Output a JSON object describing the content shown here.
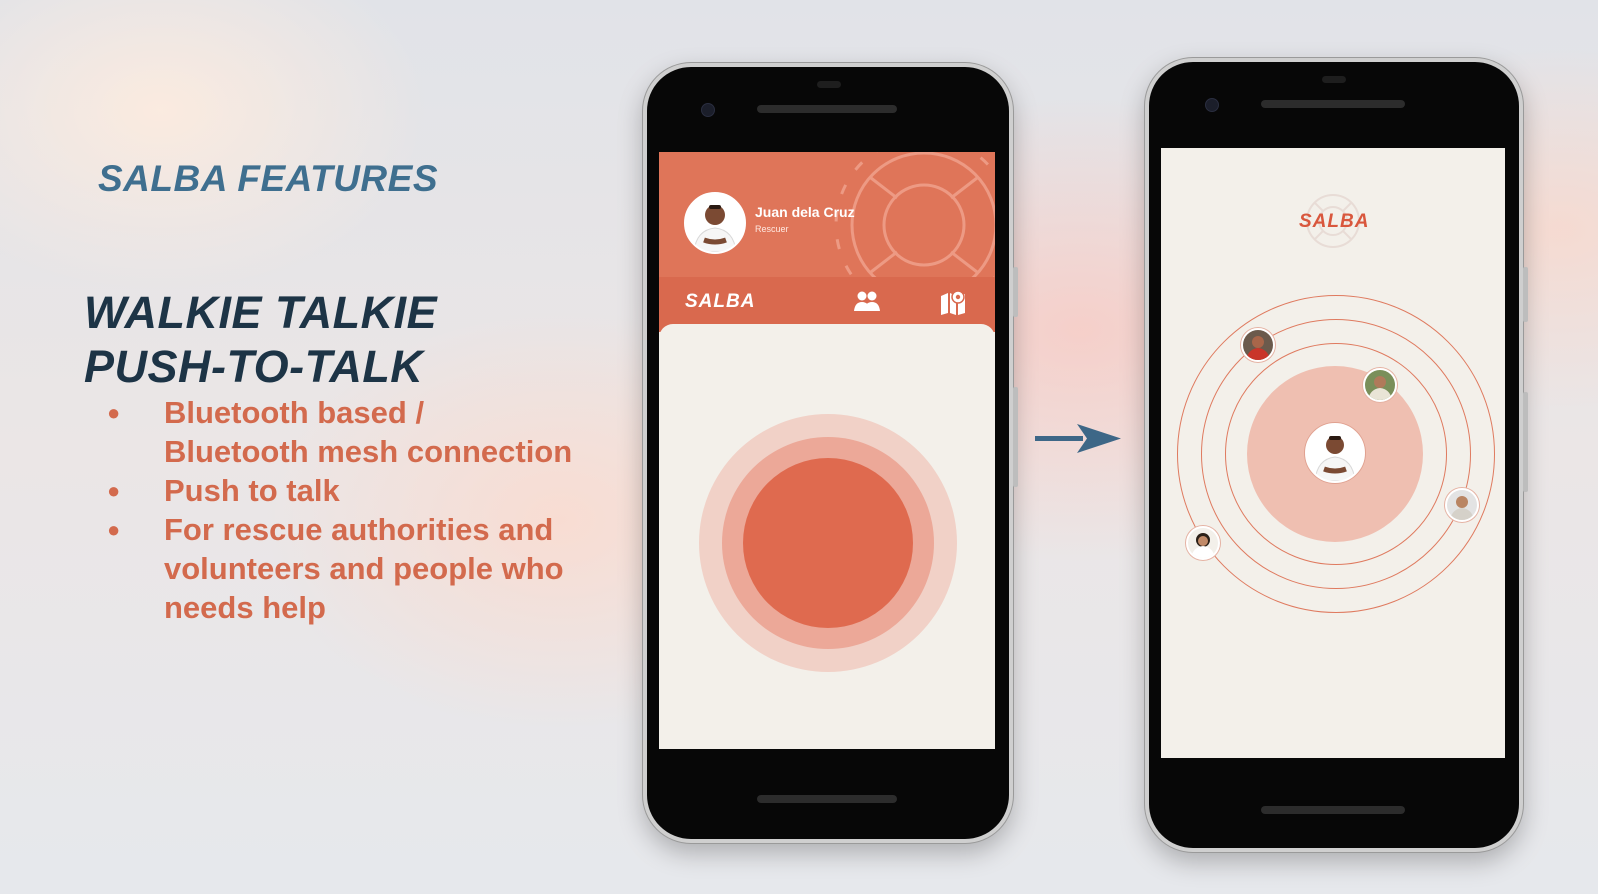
{
  "slide": {
    "title": "SALBA FEATURES",
    "heading_line1": "WALKIE TALKIE",
    "heading_line2": "PUSH-TO-TALK",
    "bullet_marker": "●",
    "bullets": [
      "Bluetooth based / Bluetooth mesh connection",
      "Push to talk",
      "For rescue authorities and volunteers and people who needs help"
    ]
  },
  "phone1": {
    "user": {
      "name": "Juan dela Cruz",
      "role": "Rescuer"
    },
    "brand": "SALBA",
    "nav_icons": [
      "group-icon",
      "map-pin-icon"
    ]
  },
  "phone2": {
    "brand": "SALBA",
    "peer_count": 4
  },
  "colors": {
    "title": "#3f6f8f",
    "heading": "#1d3446",
    "bullet_text": "#d36a4d",
    "accent": "#df7559",
    "ptt_button": "#df6a4f",
    "screen_bg": "#f3f0ea",
    "arrow": "#3d6787"
  }
}
